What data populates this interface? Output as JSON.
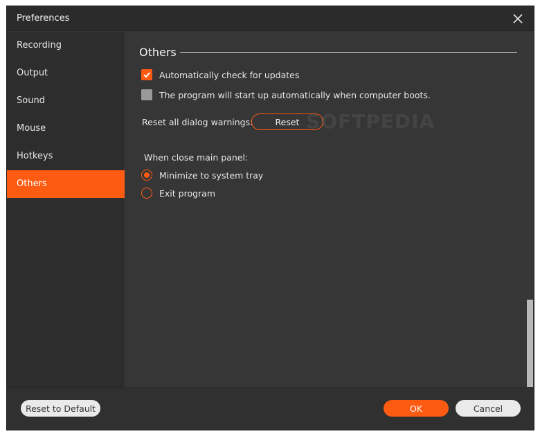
{
  "window": {
    "title": "Preferences"
  },
  "sidebar": {
    "items": [
      {
        "label": "Recording",
        "active": false
      },
      {
        "label": "Output",
        "active": false
      },
      {
        "label": "Sound",
        "active": false
      },
      {
        "label": "Mouse",
        "active": false
      },
      {
        "label": "Hotkeys",
        "active": false
      },
      {
        "label": "Others",
        "active": true
      }
    ]
  },
  "content": {
    "section_title": "Others",
    "auto_update": {
      "label": "Automatically check for updates",
      "checked": true
    },
    "auto_start": {
      "label": "The program will start up automatically when computer boots.",
      "checked": false
    },
    "reset_warnings": {
      "label": "Reset all dialog warnings:",
      "button_label": "Reset"
    },
    "close_panel": {
      "heading": "When close main panel:",
      "options": [
        {
          "label": "Minimize to system tray",
          "selected": true
        },
        {
          "label": "Exit program",
          "selected": false
        }
      ]
    }
  },
  "footer": {
    "reset_default_label": "Reset to Default",
    "ok_label": "OK",
    "cancel_label": "Cancel"
  },
  "watermark": "SOFTPEDIA",
  "colors": {
    "accent": "#fd5a12",
    "background": "#363636",
    "sidebar": "#2d2d2d"
  }
}
